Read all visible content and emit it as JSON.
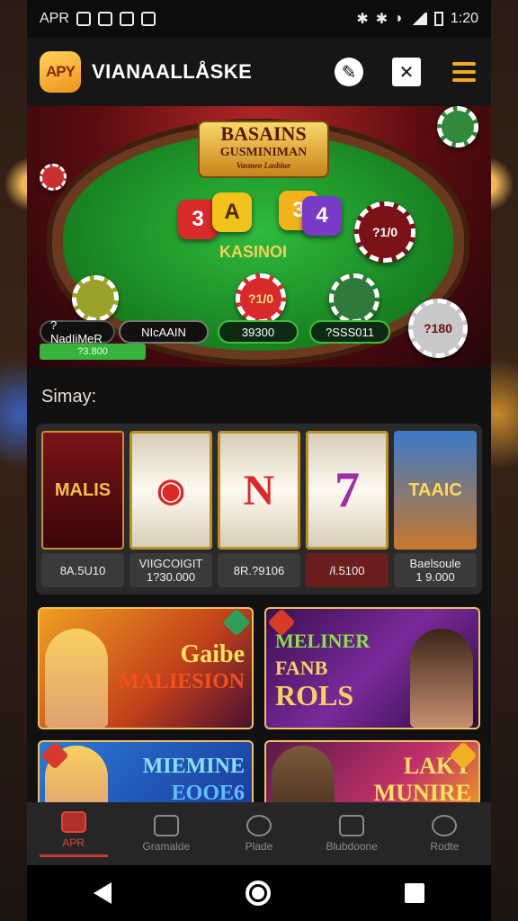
{
  "status_bar": {
    "carrier": "APR",
    "time": "1:20"
  },
  "app_bar": {
    "logo_text": "APY",
    "title": "VIANAALLÅSKE"
  },
  "hero": {
    "title_line1": "BASAINS",
    "title_line2": "GUSMINIMAN",
    "title_line3": "Vasmeo Lasbiue",
    "felt_text": "KASINOI",
    "dice": [
      "3",
      "A",
      "3",
      "4"
    ],
    "chips": [
      "?1/0",
      "?180",
      "?1/0"
    ],
    "pills": [
      "?NadIiMeR",
      "NIcAAIN",
      "39300",
      "?SSS011"
    ],
    "sub_label": "?3.800"
  },
  "section": {
    "title": "Simay:"
  },
  "slots": [
    {
      "art_text": "MALIS",
      "caption_1": "8A.5U10",
      "caption_2": ""
    },
    {
      "art_text": "",
      "caption_1": "VIIGCOIGIT",
      "caption_2": "1?30.000"
    },
    {
      "art_text": "N",
      "caption_1": "8R.?9106",
      "caption_2": ""
    },
    {
      "art_text": "7",
      "caption_1": "/ł.5100",
      "caption_2": ""
    },
    {
      "art_text": "TAAIC",
      "caption_1": "Baelsoule",
      "caption_2": "1 9.000"
    }
  ],
  "banners": [
    {
      "lines": [
        "Gaibe",
        "MALIESION"
      ]
    },
    {
      "lines": [
        "MELINER",
        "FANB",
        "ROLS"
      ]
    },
    {
      "lines": [
        "MIEMINE",
        "EOOE6"
      ]
    },
    {
      "lines": [
        "LAKY",
        "MUNIRE"
      ]
    }
  ],
  "tabs": [
    {
      "label": "APR",
      "active": true
    },
    {
      "label": "Gramalde",
      "active": false
    },
    {
      "label": "Plade",
      "active": false
    },
    {
      "label": "Blubdoone",
      "active": false
    },
    {
      "label": "Rodte",
      "active": false
    }
  ]
}
